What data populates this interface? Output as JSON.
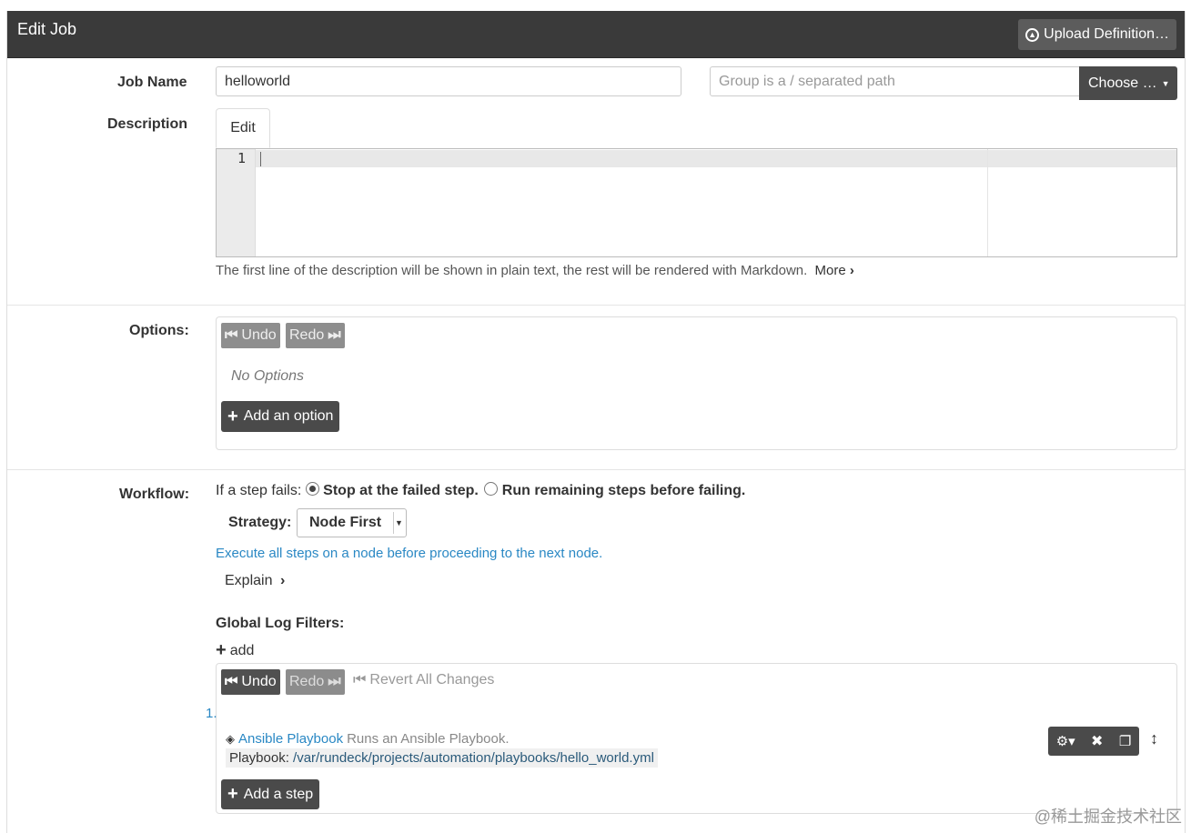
{
  "header": {
    "title": "Edit Job",
    "upload_label": "Upload Definition…"
  },
  "job_name": {
    "label": "Job Name",
    "value": "helloworld"
  },
  "group": {
    "placeholder": "Group is a / separated path",
    "choose_label": "Choose …"
  },
  "description": {
    "label": "Description",
    "tab_label": "Edit",
    "line_number": "1",
    "help_text": "The first line of the description will be shown in plain text, the rest will be rendered with Markdown.",
    "more_label": "More"
  },
  "options": {
    "label": "Options:",
    "undo_label": "Undo",
    "redo_label": "Redo",
    "empty_text": "No Options",
    "add_label": "Add an option"
  },
  "workflow": {
    "label": "Workflow:",
    "if_fails_text": "If a step fails:",
    "stop_label": "Stop at the failed step.",
    "run_remaining_label": "Run remaining steps before failing.",
    "strategy_label": "Strategy:",
    "strategy_value": "Node First",
    "strategy_description": "Execute all steps on a node before proceeding to the next node.",
    "explain_label": "Explain",
    "log_filters_label": "Global Log Filters:",
    "add_label": "add",
    "undo_label": "Undo",
    "redo_label": "Redo",
    "revert_label": "Revert All Changes",
    "step_number": "1.",
    "step_type": "Ansible Playbook",
    "step_type_description": "Runs an Ansible Playbook.",
    "playbook_label": "Playbook:",
    "playbook_path": "/var/rundeck/projects/automation/playbooks/hello_world.yml",
    "add_step_label": "Add a step"
  },
  "watermark": "@稀土掘金技术社区",
  "colors": {
    "header_bg": "#3a3a3a",
    "dark_button": "#4a4a4a",
    "link": "#2a88c4"
  }
}
